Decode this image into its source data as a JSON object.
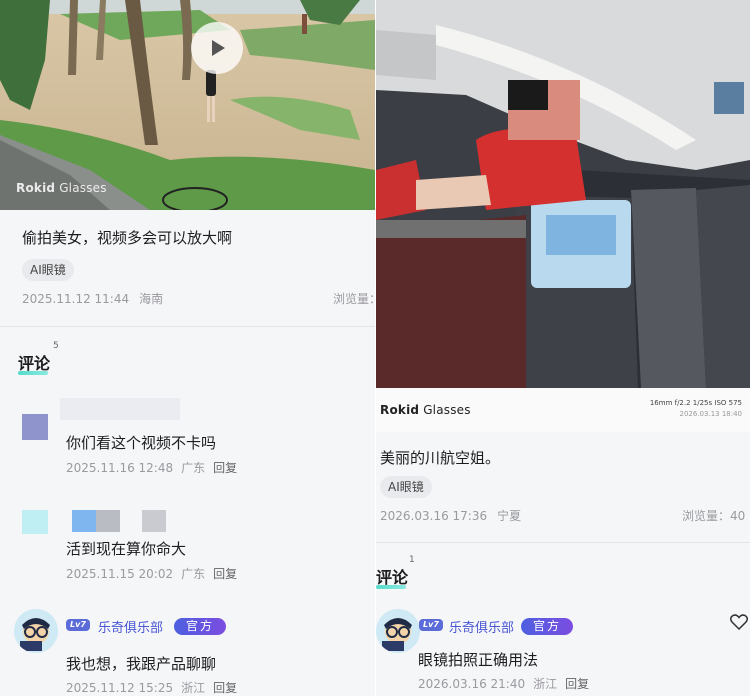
{
  "left": {
    "media": {
      "type": "video",
      "brand": {
        "bold": "Rokid",
        "regular": "Glasses"
      },
      "play_icon": "play-icon"
    },
    "post": {
      "title": "偷拍美女，视频多会可以放大啊",
      "tag": "AI眼镜",
      "date": "2025.11.12 11:44",
      "location": "海南",
      "views": "浏览量："
    },
    "comments_header": {
      "label": "评论",
      "count": "5"
    },
    "comments": [
      {
        "text": "你们看这个视频不卡吗",
        "date": "2025.11.16 12:48",
        "location": "广东",
        "reply": "回复"
      },
      {
        "text": "活到现在算你命大",
        "date": "2025.11.15 20:02",
        "location": "广东",
        "reply": "回复"
      },
      {
        "user": "乐奇俱乐部",
        "level": "Lv7",
        "badge": "官方",
        "text": "我也想，我跟产品聊聊",
        "date": "2025.11.12 15:25",
        "location": "浙江",
        "reply": "回复"
      }
    ]
  },
  "right": {
    "media": {
      "type": "photo",
      "brand": {
        "bold": "Rokid",
        "regular": "Glasses"
      },
      "camera_info": "16mm f/2.2 1/25s ISO 575",
      "camera_date": "2026.03.13 18:40"
    },
    "post": {
      "title": "美丽的川航空姐。",
      "tag": "AI眼镜",
      "date": "2026.03.16 17:36",
      "location": "宁夏",
      "views": "浏览量：40"
    },
    "comments_header": {
      "label": "评论",
      "count": "1"
    },
    "comments": [
      {
        "user": "乐奇俱乐部",
        "level": "Lv7",
        "badge": "官方",
        "text": "眼镜拍照正确用法",
        "date": "2026.03.16 21:40",
        "location": "浙江",
        "reply": "回复",
        "like_icon": "heart-icon"
      }
    ]
  },
  "colors": {
    "accent_blue": "#4a56d6",
    "badge_gradient_start": "#4d5fe0",
    "badge_gradient_end": "#7c4de0",
    "meta_gray": "#9a9a9f"
  }
}
